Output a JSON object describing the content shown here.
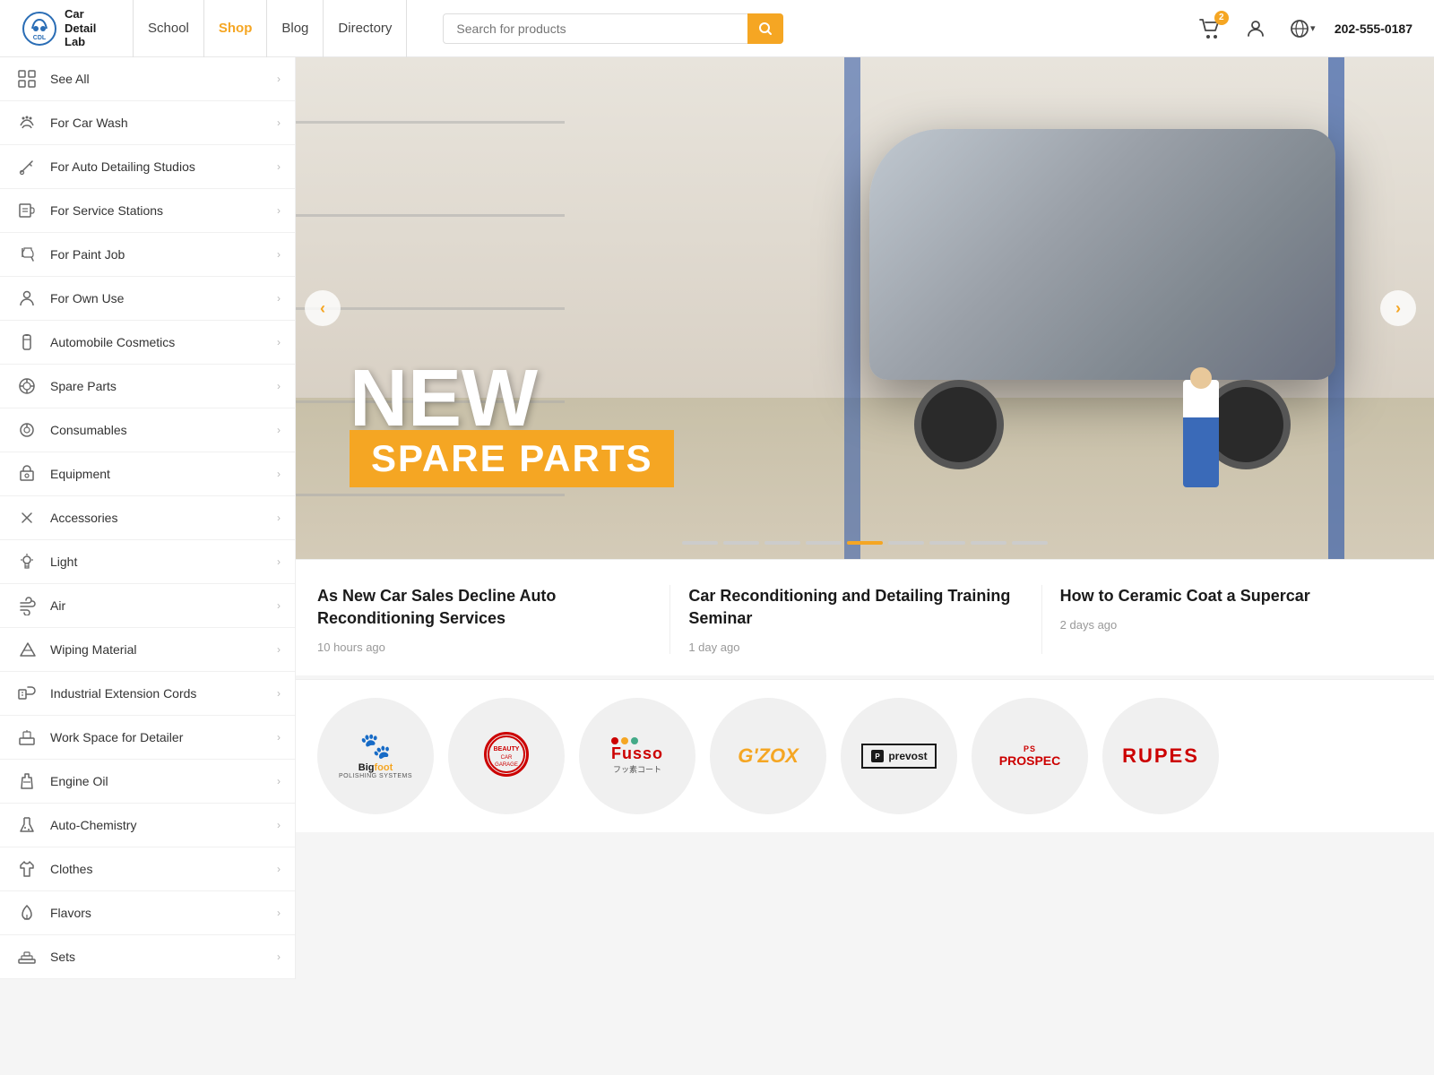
{
  "header": {
    "logo_text": "Car\nDetail\nLab",
    "nav_items": [
      {
        "label": "School",
        "active": false
      },
      {
        "label": "Shop",
        "active": true
      },
      {
        "label": "Blog",
        "active": false
      },
      {
        "label": "Directory",
        "active": false
      }
    ],
    "search_placeholder": "Search for products",
    "cart_count": "2",
    "phone": "202-555-0187"
  },
  "sidebar": {
    "items": [
      {
        "label": "See All",
        "icon": "grid"
      },
      {
        "label": "For Car Wash",
        "icon": "droplet"
      },
      {
        "label": "For Auto Detailing Studios",
        "icon": "tool"
      },
      {
        "label": "For Service Stations",
        "icon": "wrench"
      },
      {
        "label": "For Paint Job",
        "icon": "spray"
      },
      {
        "label": "For Own Use",
        "icon": "person"
      },
      {
        "label": "Automobile Cosmetics",
        "icon": "cosmetics"
      },
      {
        "label": "Spare Parts",
        "icon": "parts"
      },
      {
        "label": "Consumables",
        "icon": "consumables"
      },
      {
        "label": "Equipment",
        "icon": "equipment"
      },
      {
        "label": "Accessories",
        "icon": "accessories"
      },
      {
        "label": "Light",
        "icon": "light"
      },
      {
        "label": "Air",
        "icon": "air"
      },
      {
        "label": "Wiping Material",
        "icon": "wipe"
      },
      {
        "label": "Industrial Extension Cords",
        "icon": "cord"
      },
      {
        "label": "Work Space for Detailer",
        "icon": "workspace"
      },
      {
        "label": "Engine Oil",
        "icon": "oil"
      },
      {
        "label": "Auto-Chemistry",
        "icon": "chemistry"
      },
      {
        "label": "Clothes",
        "icon": "clothes"
      },
      {
        "label": "Flavors",
        "icon": "flavors"
      },
      {
        "label": "Sets",
        "icon": "sets"
      }
    ]
  },
  "hero": {
    "badge_new": "NEW",
    "badge_sub": "SPARE PARTS",
    "dots_count": 9,
    "active_dot": 5
  },
  "news": [
    {
      "title": "As New Car Sales Decline Auto Reconditioning Services",
      "time": "10 hours ago"
    },
    {
      "title": "Car Reconditioning and Detailing Training Seminar",
      "time": "1 day ago"
    },
    {
      "title": "How to Ceramic Coat a Supercar",
      "time": "2 days ago"
    }
  ],
  "brands": [
    {
      "name": "Bigfoot POLishing SYSTEMs",
      "key": "bigfoot"
    },
    {
      "name": "Beauty Car Garage",
      "key": "beauty"
    },
    {
      "name": "Fusso Coat",
      "key": "fusso"
    },
    {
      "name": "G'ZOX",
      "key": "gzox"
    },
    {
      "name": "Prevost",
      "key": "prevost"
    },
    {
      "name": "PS Prospec",
      "key": "prospec"
    },
    {
      "name": "RUPES",
      "key": "rupes"
    }
  ]
}
